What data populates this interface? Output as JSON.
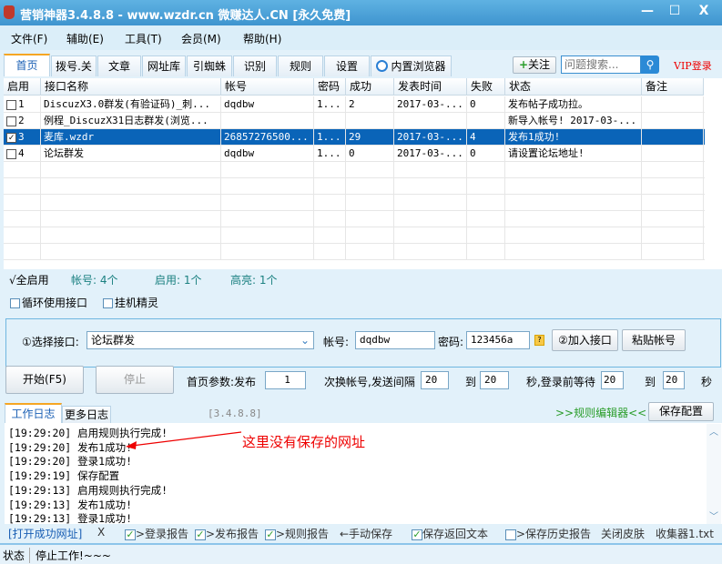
{
  "window": {
    "title": "营销神器3.4.8.8 - www.wzdr.cn 微赚达人.CN [永久免费]",
    "minimize": "—",
    "maximize": "☐",
    "close": "X"
  },
  "menu": [
    "文件(F)",
    "辅助(E)",
    "工具(T)",
    "会员(M)",
    "帮助(H)"
  ],
  "tabs": [
    "首页",
    "拨号.关",
    "文章",
    "网址库",
    "引蜘蛛",
    "识别",
    "规则",
    "设置",
    "内置浏览器"
  ],
  "follow_label": "关注",
  "search": {
    "placeholder": "问题搜索..."
  },
  "vip_login": "VIP登录",
  "table": {
    "columns": [
      "启用",
      "接口名称",
      "帐号",
      "密码",
      "成功",
      "发表时间",
      "失败",
      "状态",
      "备注"
    ],
    "rows": [
      {
        "checked": false,
        "id": "1",
        "name": "DiscuzX3.0群发(有验证码)_刺...",
        "account": "dqdbw",
        "password": "1...",
        "success": "2",
        "time": "2017-03-...",
        "fail": "0",
        "status": "发布帖子成功拉。",
        "note": ""
      },
      {
        "checked": false,
        "id": "2",
        "name": "例程_DiscuzX31日志群发(浏览...",
        "account": "",
        "password": "",
        "success": "",
        "time": "",
        "fail": "",
        "status": "新导入帐号! 2017-03-...",
        "note": ""
      },
      {
        "checked": true,
        "id": "3",
        "name": "麦库.wzdr",
        "account": "26857276500...",
        "password": "1...",
        "success": "29",
        "time": "2017-03-...",
        "fail": "4",
        "status": "发布1成功!",
        "note": "",
        "selected": true
      },
      {
        "checked": false,
        "id": "4",
        "name": "论坛群发",
        "account": "dqdbw",
        "password": "1...",
        "success": "0",
        "time": "2017-03-...",
        "fail": "0",
        "status": "请设置论坛地址!",
        "note": ""
      }
    ]
  },
  "summary": {
    "enable_all": "√全启用",
    "accounts": "帐号: 4个",
    "enabled": "启用: 1个",
    "highlight": "高亮: 1个"
  },
  "options": {
    "loop": "循环使用接口",
    "hang": "挂机精灵"
  },
  "add": {
    "select_label": "①选择接口:",
    "select_value": "论坛群发",
    "account_label": "帐号:",
    "account_value": "dqdbw",
    "password_label": "密码:",
    "password_value": "123456a",
    "help": "?",
    "add_button": "②加入接口",
    "paste_button": "粘贴帐号"
  },
  "controls": {
    "start": "开始(F5)",
    "stop": "停止",
    "params_label": "首页参数:发布",
    "publish_count": "1",
    "interval_label": "次换帐号,发送间隔",
    "interval_from": "20",
    "to1": "到",
    "interval_to": "20",
    "wait_label": "秒,登录前等待",
    "wait_from": "20",
    "to2": "到",
    "wait_to": "20",
    "sec": "秒"
  },
  "log_tabs": {
    "work": "工作日志",
    "more": "更多日志",
    "version": "[3.4.8.8]",
    "rule_editor": ">>规则编辑器<<",
    "save_config": "保存配置"
  },
  "log": [
    "[19:29:20] 启用规则执行完成!",
    "[19:29:20] 发布1成功!",
    "[19:29:20] 登录1成功!",
    "[19:29:19] 保存配置",
    "[19:29:13] 启用规则执行完成!",
    "[19:29:13] 发布1成功!",
    "[19:29:13] 登录1成功!"
  ],
  "annotation": "这里没有保存的网址",
  "bottom": {
    "open_url": "[打开成功网址]",
    "x": "X",
    "login_report": ">登录报告",
    "publish_report": ">发布报告",
    "rule_report": ">规则报告",
    "manual_save": "←手动保存",
    "save_return": "保存返回文本",
    "save_history": ">保存历史报告",
    "close_skin": "关闭皮肤",
    "collector": "收集器1.txt"
  },
  "status": {
    "label": "状态",
    "text": "停止工作!~~~"
  }
}
